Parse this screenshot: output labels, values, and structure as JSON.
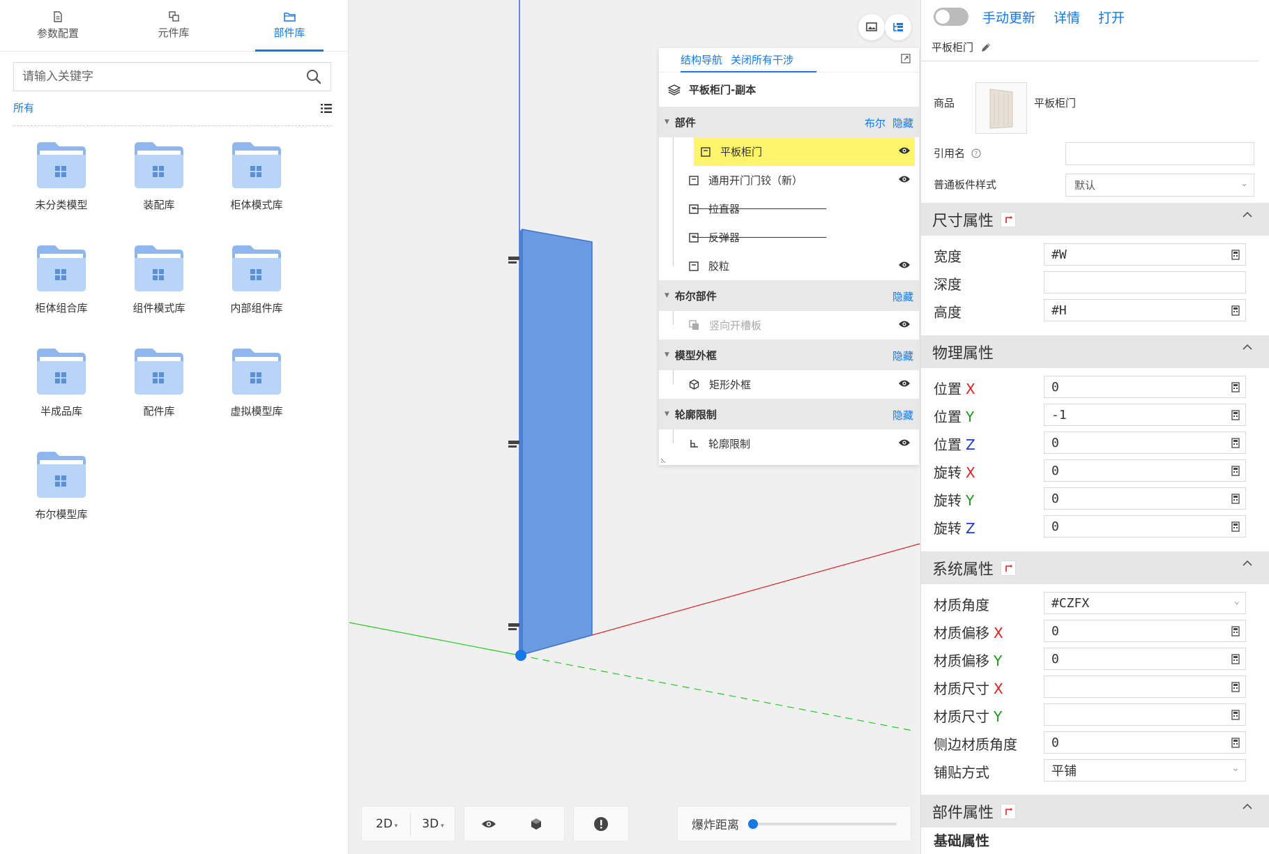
{
  "left_tabs": [
    {
      "label": "参数配置",
      "icon": "document-icon"
    },
    {
      "label": "元件库",
      "icon": "component-icon"
    },
    {
      "label": "部件库",
      "icon": "folder-tab-icon",
      "active": true
    }
  ],
  "search": {
    "placeholder": "请输入关键字"
  },
  "filter": {
    "all_label": "所有"
  },
  "folders": [
    "未分类模型",
    "装配库",
    "柜体模式库",
    "柜体组合库",
    "组件模式库",
    "内部组件库",
    "半成品库",
    "配件库",
    "虚拟模型库",
    "布尔模型库"
  ],
  "tree": {
    "tab1": "结构导航",
    "tab2": "关闭所有干涉",
    "root": "平板柜门-副本",
    "groups": {
      "parts": {
        "title": "部件",
        "act1": "布尔",
        "act2": "隐藏"
      },
      "bool_parts": {
        "title": "布尔部件",
        "act": "隐藏"
      },
      "outer": {
        "title": "模型外框",
        "act": "隐藏"
      },
      "contour": {
        "title": "轮廓限制",
        "act": "隐藏"
      }
    },
    "nodes": {
      "door": "平板柜门",
      "hinge": "通用开门门铰（新）",
      "puller": "拉直器",
      "rebound": "反弹器",
      "bumper": "胶粒",
      "slot": "竖向开槽板",
      "box": "矩形外框",
      "limit": "轮廓限制"
    }
  },
  "bottom": {
    "view2d": "2D",
    "view3d": "3D",
    "explode_label": "爆炸距离",
    "explode_value": 0
  },
  "right": {
    "top_links": [
      "手动更新",
      "详情",
      "打开"
    ],
    "part_name": "平板柜门",
    "goods_label": "商品",
    "goods_name": "平板柜门",
    "ref_label": "引用名",
    "style_label": "普通板件样式",
    "style_value": "默认",
    "sections": {
      "size": "尺寸属性",
      "physics": "物理属性",
      "system": "系统属性",
      "component": "部件属性"
    },
    "size": {
      "width_label": "宽度",
      "width_value": "#W",
      "depth_label": "深度",
      "depth_value": "",
      "height_label": "高度",
      "height_value": "#H"
    },
    "physics": {
      "pos_label": "位置",
      "rot_label": "旋转",
      "axis_x": "X",
      "axis_y": "Y",
      "axis_z": "Z",
      "pos_x": "0",
      "pos_y": "-1",
      "pos_z": "0",
      "rot_x": "0",
      "rot_y": "0",
      "rot_z": "0"
    },
    "system": {
      "angle_label": "材质角度",
      "angle_value": "#CZFX",
      "offset_label": "材质偏移",
      "offset_x": "0",
      "offset_y": "0",
      "size_label": "材质尺寸",
      "size_x": "",
      "size_y": "",
      "edge_label": "侧边材质角度",
      "edge_value": "0",
      "paste_label": "铺贴方式",
      "paste_value": "平铺"
    },
    "basic_label": "基础属性"
  },
  "colors": {
    "accent": "#1677e6",
    "selected_row": "#fff56b",
    "panel_blue": "#5b8fd6",
    "axis_x": "#e02020",
    "axis_y": "#1a9a1a",
    "axis_z": "#1a3ad0"
  }
}
